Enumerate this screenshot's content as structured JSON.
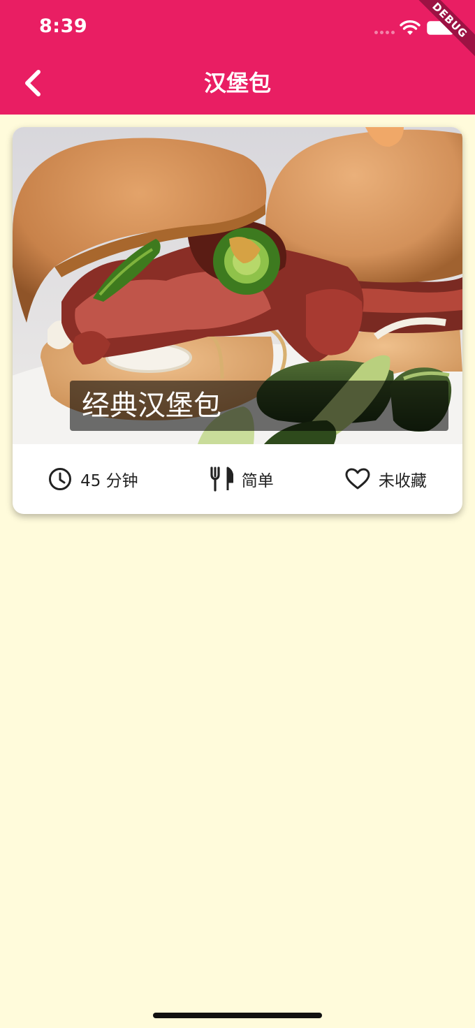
{
  "status_bar": {
    "time": "8:39",
    "debug_label": "DEBUG"
  },
  "app_bar": {
    "title": "汉堡包",
    "back_icon": "chevron-left-icon",
    "background_color": "#E91E63"
  },
  "recipe_card": {
    "name": "经典汉堡包",
    "image": "burger-photo",
    "duration": "45 分钟",
    "duration_icon": "clock-icon",
    "difficulty": "简单",
    "difficulty_icon": "fork-knife-icon",
    "favorite_status": "未收藏",
    "favorite_icon": "heart-outline-icon"
  },
  "colors": {
    "page_background": "#FFFBDB",
    "accent": "#E91E63"
  }
}
